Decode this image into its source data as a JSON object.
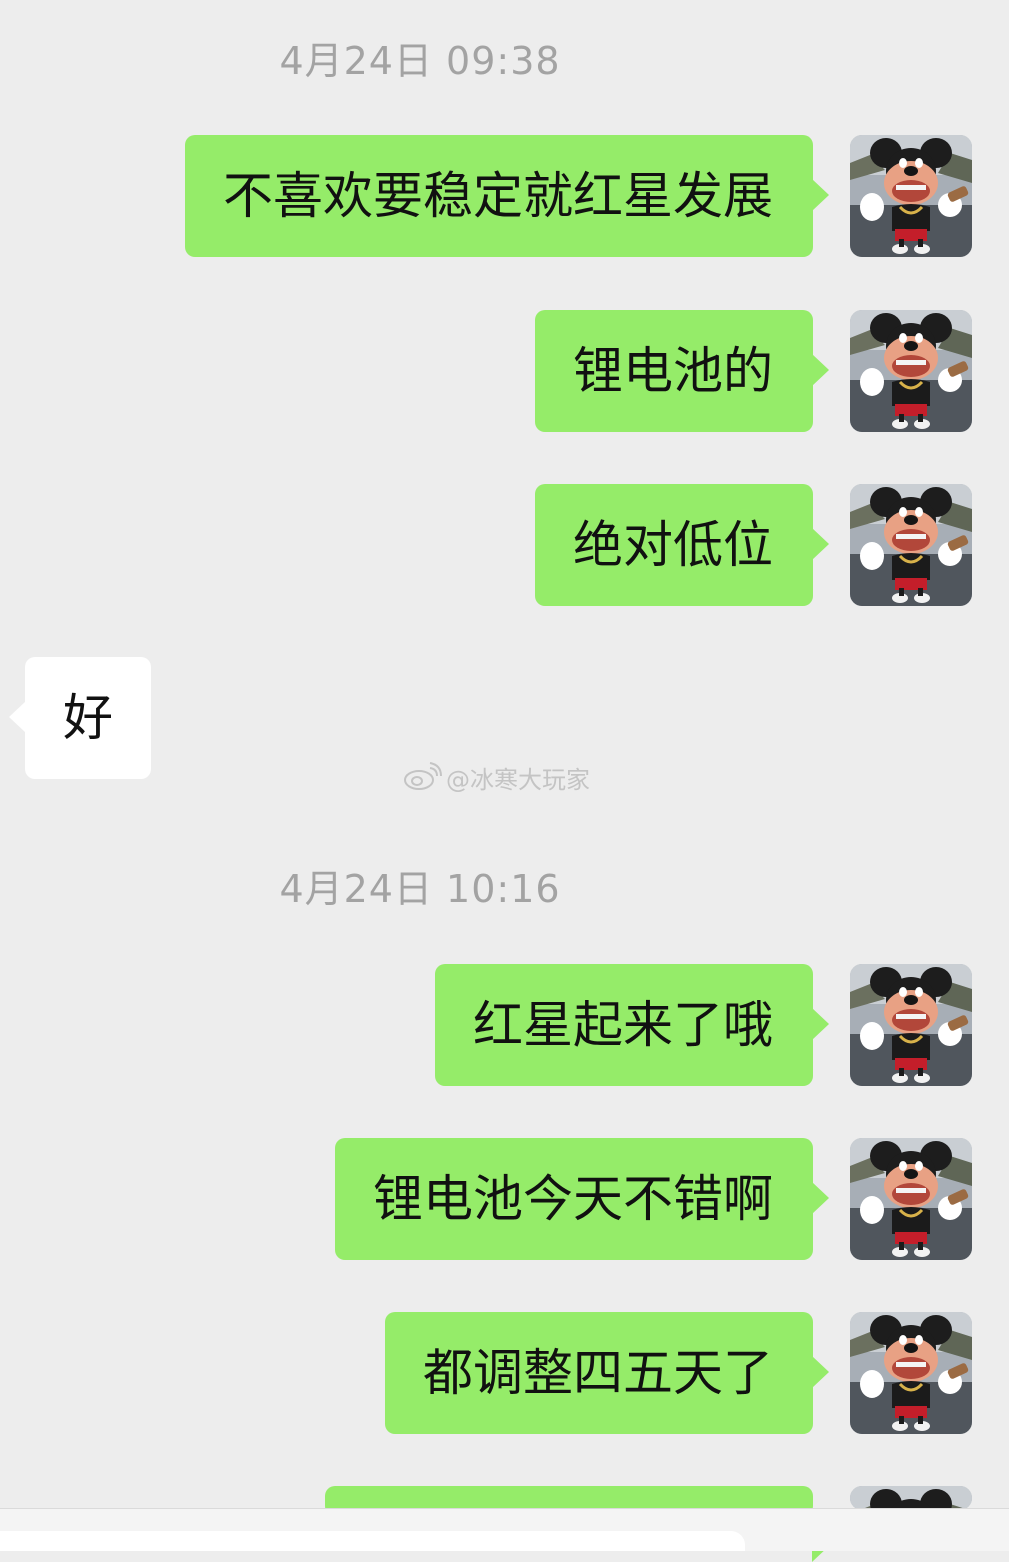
{
  "timestamps": [
    "4月24日 09:38",
    "4月24日 10:16"
  ],
  "messages": [
    {
      "text": "不喜欢要稳定就红星发展",
      "direction": "sent"
    },
    {
      "text": "锂电池的",
      "direction": "sent"
    },
    {
      "text": "绝对低位",
      "direction": "sent"
    },
    {
      "text": "好",
      "direction": "received"
    },
    {
      "text": "红星起来了哦",
      "direction": "sent"
    },
    {
      "text": "锂电池今天不错啊",
      "direction": "sent"
    },
    {
      "text": "都调整四五天了",
      "direction": "sent"
    }
  ],
  "watermark": {
    "text": "@冰寒大玩家",
    "icon": "weibo-icon"
  },
  "avatar": {
    "icon": "mickey-avatar-icon"
  },
  "colors": {
    "background": "#ededed",
    "sent_bubble": "#95ec69",
    "received_bubble": "#ffffff",
    "timestamp_text": "#a3a3a3"
  }
}
